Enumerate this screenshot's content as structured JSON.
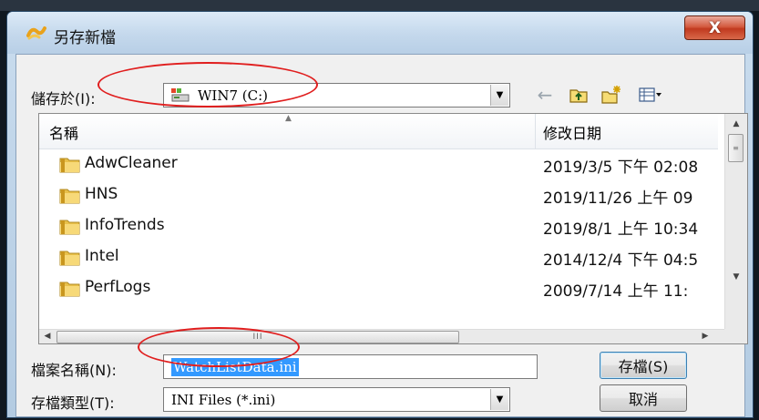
{
  "window": {
    "title": "另存新檔",
    "close_glyph": "X"
  },
  "save_in": {
    "label": "儲存於(I):",
    "value": "WIN7 (C:)"
  },
  "toolbar": {
    "back_icon": "back-arrow-icon",
    "up_icon": "up-folder-icon",
    "new_folder_icon": "new-folder-icon",
    "view_icon": "view-menu-icon"
  },
  "file_list": {
    "columns": {
      "name": "名稱",
      "date": "修改日期"
    },
    "rows": [
      {
        "name": "AdwCleaner",
        "date": "2019/3/5 下午 02:08"
      },
      {
        "name": "HNS",
        "date": "2019/11/26 上午 09"
      },
      {
        "name": "InfoTrends",
        "date": "2019/8/1 上午 10:34"
      },
      {
        "name": "Intel",
        "date": "2014/12/4 下午 04:5"
      },
      {
        "name": "PerfLogs",
        "date": "2009/7/14 上午 11:"
      }
    ],
    "hscroll_grip": "III"
  },
  "file_name": {
    "label": "檔案名稱(N):",
    "value": "WatchListData.ini"
  },
  "file_type": {
    "label": "存檔類型(T):",
    "value": "INI Files (*.ini)"
  },
  "buttons": {
    "save": "存檔(S)",
    "cancel": "取消"
  },
  "colors": {
    "annotation": "#e01e1e",
    "selection": "#3399ff",
    "close_button": "#c13a1f"
  }
}
